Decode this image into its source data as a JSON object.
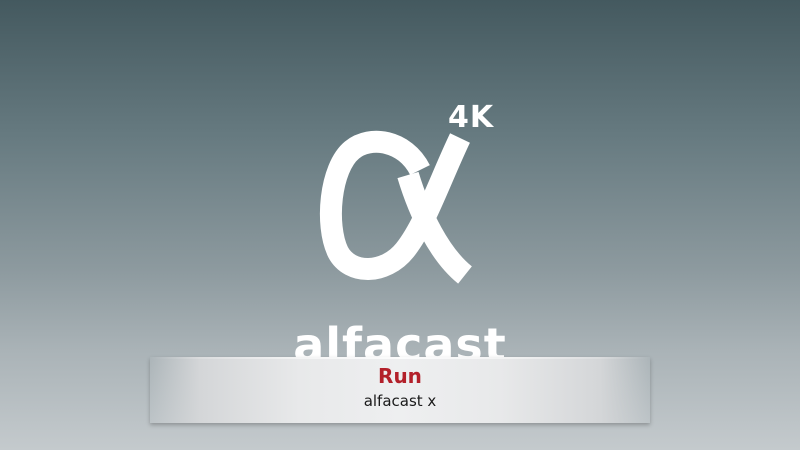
{
  "splash": {
    "logo_badge": "4K",
    "wordmark": "alfacast",
    "alpha_icon": "alpha-logo-icon",
    "colors": {
      "background_top": "#44595f",
      "background_bottom": "#c4cacd",
      "logo": "#ffffff"
    }
  },
  "action_bar": {
    "title": "Run",
    "subtitle": "alfacast x",
    "colors": {
      "title": "#b3202a",
      "subtitle": "#1a1a1a",
      "bar": "#eeeff0"
    }
  }
}
